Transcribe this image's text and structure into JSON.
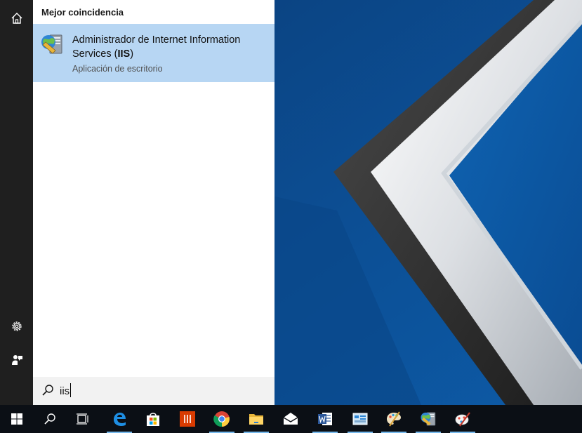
{
  "search_panel": {
    "section_header": "Mejor coincidencia",
    "best_match": {
      "title_text": "Administrador de Internet Information Services (",
      "title_bold": "IIS",
      "title_end": ")",
      "subtitle": "Aplicación de escritorio",
      "icon": "iis-manager-icon"
    }
  },
  "search": {
    "value": "iis",
    "icon": "search-icon"
  },
  "rail": {
    "items": [
      "home-icon",
      "settings-icon",
      "feedback-icon"
    ]
  },
  "taskbar": {
    "items": [
      "start-button",
      "search-button",
      "task-view",
      "edge",
      "store",
      "office",
      "chrome",
      "file-explorer",
      "mail",
      "word",
      "control-panel",
      "paint",
      "iis-manager",
      "paint-alt"
    ]
  },
  "colors": {
    "accent": "#76b9ed",
    "selection": "#b7d6f3",
    "rail": "#1f1f1f",
    "taskbar": "#0b0f15"
  }
}
